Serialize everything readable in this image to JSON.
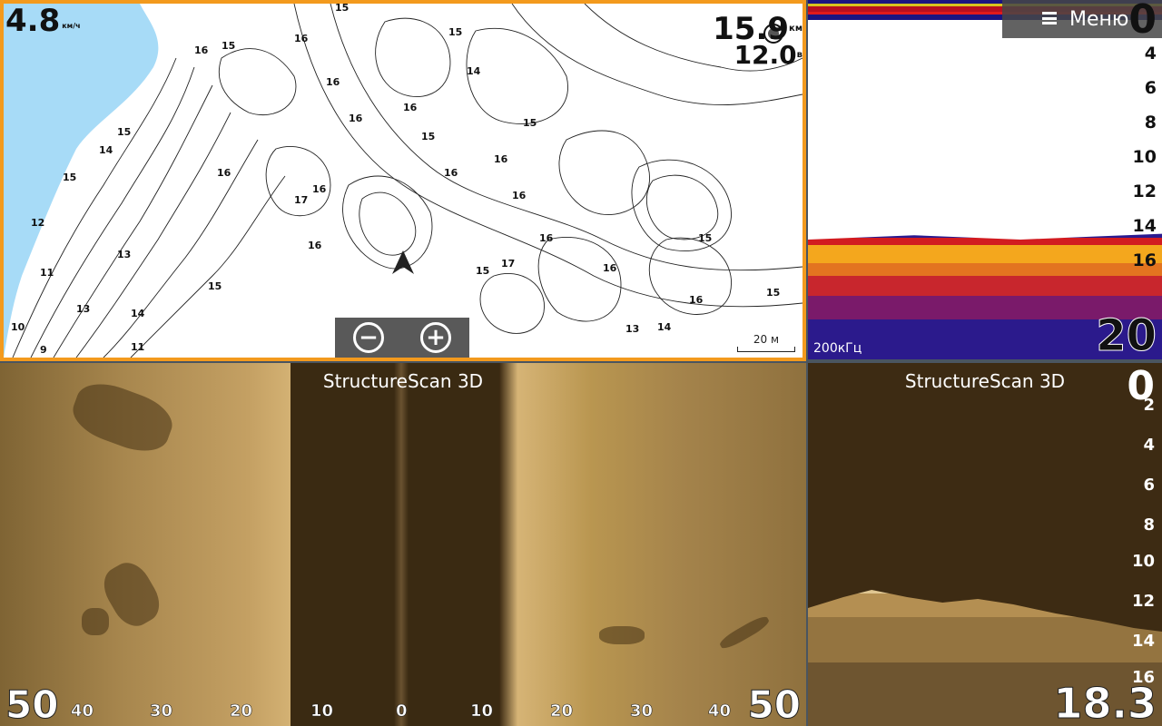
{
  "map": {
    "speed_value": "4.8",
    "speed_unit": "км/ч",
    "distance_value": "15.9",
    "distance_unit": "км",
    "depth_value": "12.0",
    "depth_unit": "в",
    "zoom_out_label": "−",
    "zoom_in_label": "+",
    "scale_label": "20 м",
    "depth_labels": [
      "15",
      "15",
      "16",
      "16",
      "15",
      "16",
      "15",
      "16",
      "16",
      "16",
      "17",
      "16",
      "15",
      "14",
      "16",
      "15",
      "13",
      "14",
      "14",
      "15",
      "16",
      "16",
      "15",
      "17",
      "16",
      "16",
      "15",
      "12",
      "11",
      "13",
      "10",
      "9",
      "11",
      "16",
      "16",
      "15",
      "15",
      "13",
      "14"
    ]
  },
  "sonar": {
    "menu_label": "Меню",
    "top_value": "0",
    "scale": [
      "4",
      "6",
      "8",
      "10",
      "12",
      "14",
      "16"
    ],
    "bottom_value": "20",
    "frequency": "200кГц"
  },
  "structure_side": {
    "title": "StructureScan 3D",
    "range_left": "50",
    "range_right": "50",
    "ticks": [
      "40",
      "30",
      "20",
      "10",
      "0",
      "10",
      "20",
      "30",
      "40"
    ]
  },
  "structure_down": {
    "title": "StructureScan 3D",
    "top_value": "0",
    "scale": [
      "2",
      "4",
      "6",
      "8",
      "10",
      "12",
      "14",
      "16"
    ],
    "bottom_value": "18.3"
  }
}
